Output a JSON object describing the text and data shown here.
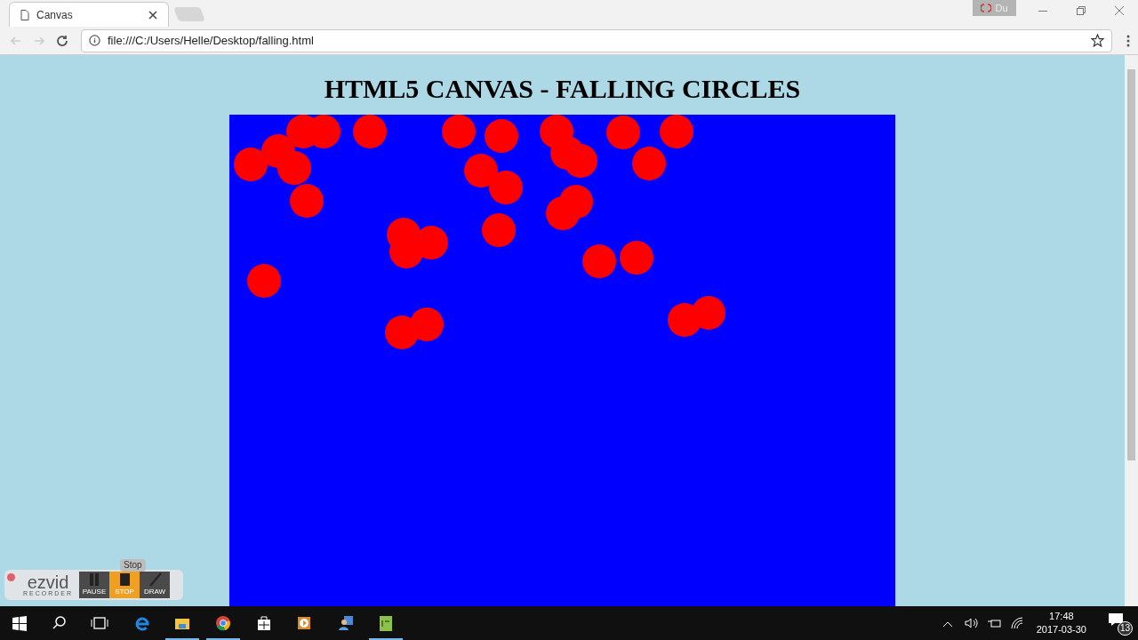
{
  "browser": {
    "tab": {
      "title": "Canvas",
      "selected": true
    },
    "profile": "Du",
    "address": "file:///C:/Users/Helle/Desktop/falling.html"
  },
  "page": {
    "heading": "HTML5 CANVAS - FALLING CIRCLES"
  },
  "recorder": {
    "logo": "ezvid",
    "subtitle": "RECORDER",
    "tooltip": "Stop",
    "buttons": [
      {
        "label": "PAUSE",
        "kind": "pause",
        "selected": false
      },
      {
        "label": "STOP",
        "kind": "stop",
        "selected": true
      },
      {
        "label": "DRAW",
        "kind": "draw",
        "selected": false
      }
    ]
  },
  "taskbar": {
    "time": "17:48",
    "date": "2017-03-30",
    "notifications": "13"
  }
}
